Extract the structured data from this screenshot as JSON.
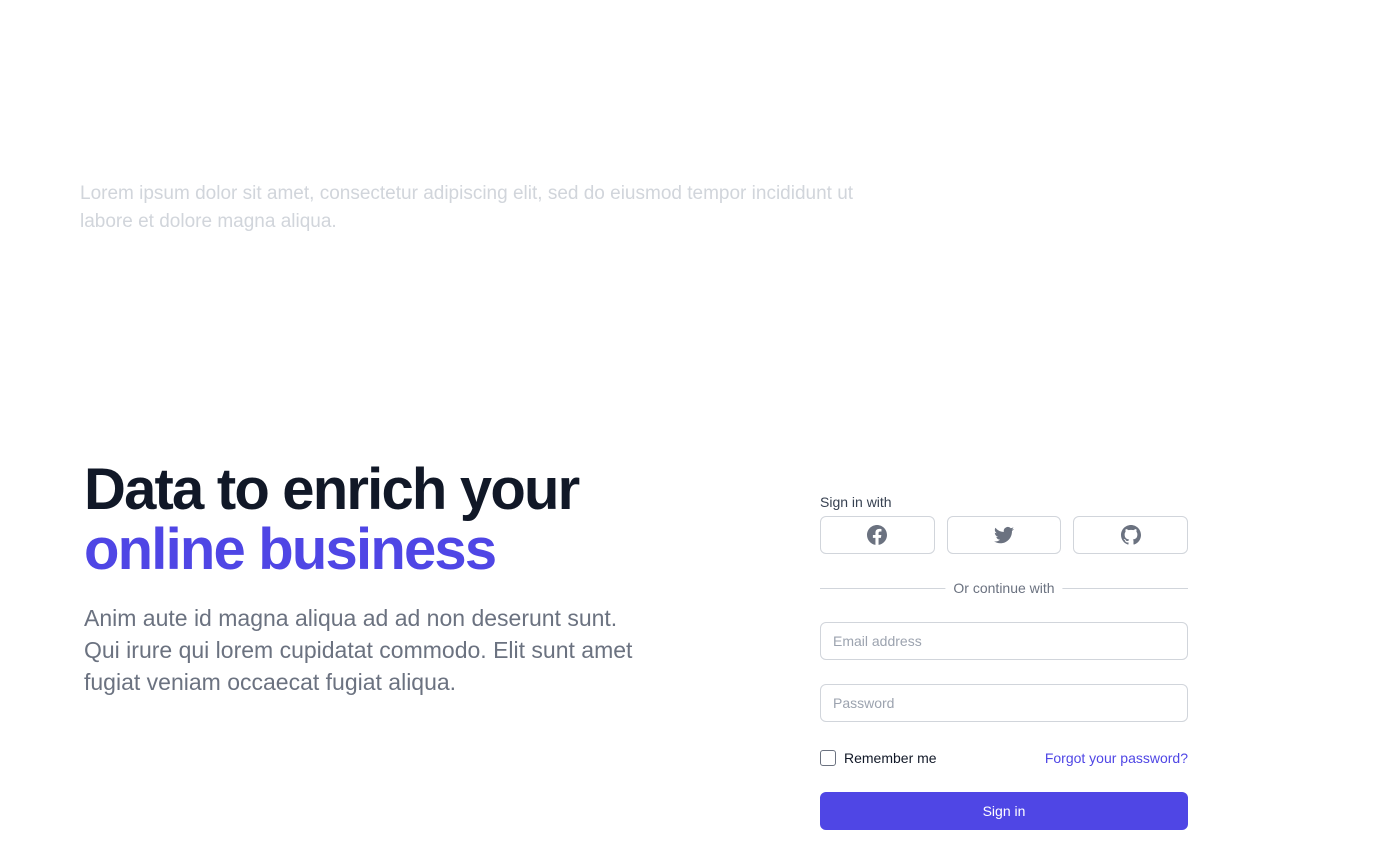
{
  "top": {
    "paragraph": "Lorem ipsum dolor sit amet, consectetur adipiscing elit, sed do eiusmod tempor incididunt ut labore et dolore magna aliqua."
  },
  "hero": {
    "title_line1": "Data to enrich your",
    "title_line2": "online business",
    "description": "Anim aute id magna aliqua ad ad non deserunt sunt. Qui irure qui lorem cupidatat commodo. Elit sunt amet fugiat veniam occaecat fugiat aliqua."
  },
  "signin": {
    "label": "Sign in with",
    "social": [
      {
        "icon": "facebook-icon"
      },
      {
        "icon": "twitter-icon"
      },
      {
        "icon": "github-icon"
      }
    ],
    "divider": "Or continue with",
    "email_placeholder": "Email address",
    "password_placeholder": "Password",
    "remember_label": "Remember me",
    "remember_checked": false,
    "forgot_label": "Forgot your password?",
    "submit_label": "Sign in"
  },
  "colors": {
    "accent": "#4f46e5",
    "heading": "#111827",
    "muted": "#6b7280",
    "faded": "#d1d5db"
  }
}
